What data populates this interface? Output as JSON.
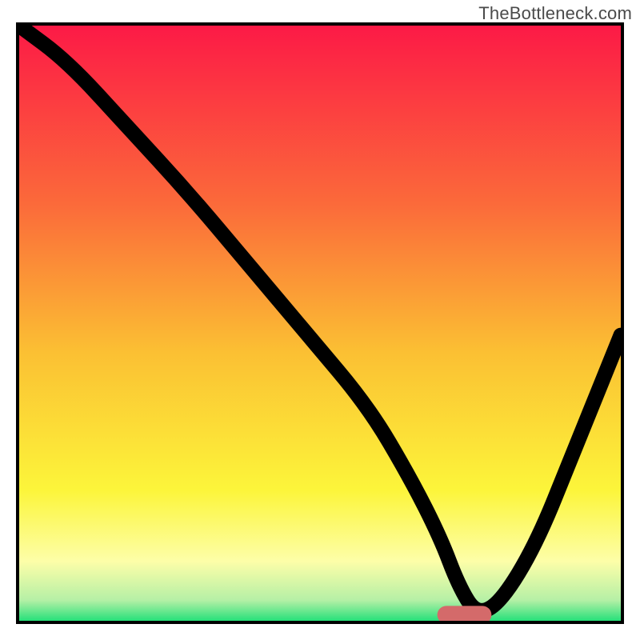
{
  "watermark": "TheBottleneck.com",
  "chart_data": {
    "type": "line",
    "title": "",
    "xlabel": "",
    "ylabel": "",
    "xlim": [
      0,
      100
    ],
    "ylim": [
      0,
      100
    ],
    "grid": false,
    "legend": false,
    "background_gradient": {
      "direction": "vertical",
      "stops": [
        {
          "offset": 0.0,
          "color": "#fc1a46"
        },
        {
          "offset": 0.3,
          "color": "#fb6a3a"
        },
        {
          "offset": 0.55,
          "color": "#fbc033"
        },
        {
          "offset": 0.78,
          "color": "#fcf53a"
        },
        {
          "offset": 0.9,
          "color": "#fdfea8"
        },
        {
          "offset": 0.965,
          "color": "#b6f0a6"
        },
        {
          "offset": 1.0,
          "color": "#26e07a"
        }
      ]
    },
    "series": [
      {
        "name": "bottleneck-curve",
        "x": [
          0,
          8,
          18,
          28,
          38,
          48,
          58,
          65,
          70,
          73,
          76,
          80,
          86,
          92,
          100
        ],
        "y": [
          100,
          94,
          83,
          72,
          60,
          48,
          36,
          24,
          14,
          6,
          1,
          3,
          13,
          28,
          48
        ]
      }
    ],
    "annotations": [
      {
        "name": "minimum-marker",
        "shape": "rounded-rect",
        "x_range": [
          70,
          78
        ],
        "y": 1,
        "color": "#d46a6a"
      }
    ]
  }
}
